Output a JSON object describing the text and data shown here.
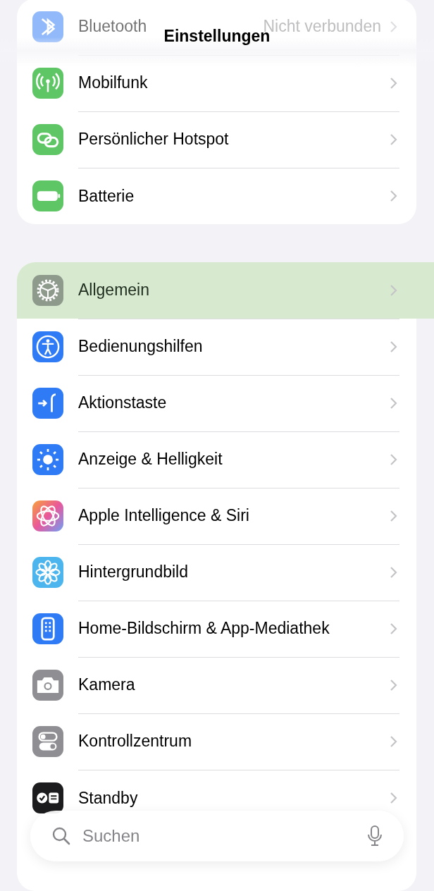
{
  "header": {
    "title": "Einstellungen"
  },
  "groups": [
    {
      "items": [
        {
          "label": "Bluetooth",
          "value": "Nicht verbunden",
          "selected": false,
          "obscured": true
        },
        {
          "label": "Mobilfunk",
          "selected": false,
          "obscured": false
        },
        {
          "label": "Persönlicher Hotspot",
          "selected": false,
          "obscured": false
        },
        {
          "label": "Batterie",
          "selected": false,
          "obscured": false
        }
      ]
    },
    {
      "items": [
        {
          "label": "Allgemein",
          "selected": true,
          "obscured": false
        },
        {
          "label": "Bedienungshilfen",
          "selected": false,
          "obscured": false
        },
        {
          "label": "Aktionstaste",
          "selected": false,
          "obscured": false
        },
        {
          "label": "Anzeige & Helligkeit",
          "selected": false,
          "obscured": false
        },
        {
          "label": "Apple Intelligence & Siri",
          "selected": false,
          "obscured": false
        },
        {
          "label": "Hintergrundbild",
          "selected": false,
          "obscured": false
        },
        {
          "label": "Home-Bildschirm & App-Mediathek",
          "selected": false,
          "obscured": false
        },
        {
          "label": "Kamera",
          "selected": false,
          "obscured": false
        },
        {
          "label": "Kontrollzentrum",
          "selected": false,
          "obscured": false
        },
        {
          "label": "Standby",
          "selected": false,
          "obscured": false
        }
      ]
    }
  ],
  "search": {
    "placeholder": "Suchen"
  }
}
